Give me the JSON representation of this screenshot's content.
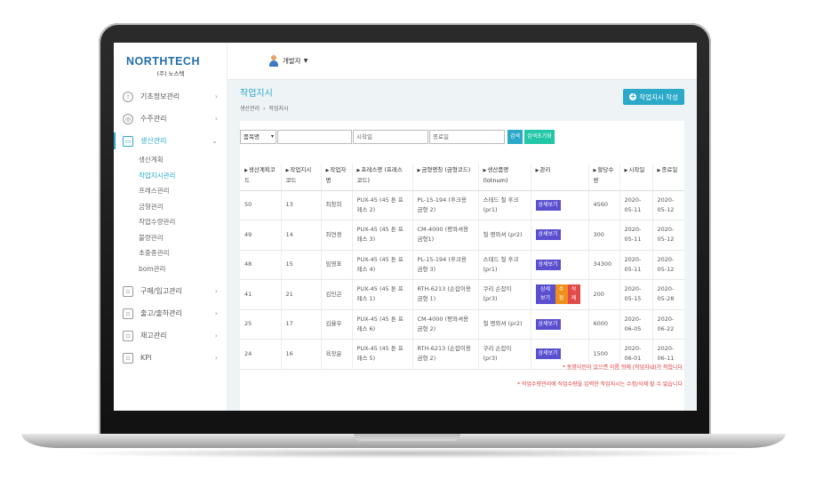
{
  "app": {
    "logo_main": "NORTHTECH",
    "logo_sub": "(주) 노스텍"
  },
  "colors": {
    "accent": "#2aa9c9",
    "detail_badge": "#5a4fcf",
    "edit_badge": "#ef8f1b",
    "delete_badge": "#e04a4a",
    "notice": "#e23a3a"
  },
  "topbar": {
    "user_name": "개발자"
  },
  "sidebar": {
    "items": [
      {
        "label": "기초정보관리",
        "icon": "info-icon"
      },
      {
        "label": "수주관리",
        "icon": "globe-icon"
      },
      {
        "label": "생산관리",
        "icon": "folder-icon"
      },
      {
        "label": "구매/입고관리",
        "icon": "cart-icon"
      },
      {
        "label": "출고/출하관리",
        "icon": "truck-icon"
      },
      {
        "label": "재고관리",
        "icon": "box-icon"
      },
      {
        "label": "KPI",
        "icon": "chart-icon"
      }
    ],
    "sub_items": [
      "생산계획",
      "작업지시관리",
      "프레스관리",
      "금형관리",
      "작업수량관리",
      "불량관리",
      "초중종관리",
      "bom관리"
    ]
  },
  "page": {
    "title": "작업지시",
    "breadcrumb": [
      "생산관리",
      "작업지시"
    ],
    "create_button": "작업지시 작성"
  },
  "search": {
    "select_value": "품목명",
    "keyword_placeholder": "",
    "start_placeholder": "시작일",
    "end_placeholder": "종료일",
    "search_button": "검색",
    "reset_button": "검색초기화"
  },
  "table": {
    "headers": [
      "생산계획코드",
      "작업지시코드",
      "작업자명",
      "프레스명 (프레스코드)",
      "금형명칭 (금형코드)",
      "생산품명 (lotnum)",
      "관리",
      "할당수량",
      "시작일",
      "종료일"
    ],
    "detail_label": "상세보기",
    "detail_label_split": "상세 보기",
    "edit_label_split": "수 정",
    "delete_label_split": "삭 제",
    "rows": [
      {
        "plan": "50",
        "order": "13",
        "worker": "최창희",
        "press": "PUX-45 (45 톤 프레스 2)",
        "mold": "PL-15-194 (후크용 금형 2)",
        "product": "스테드 철 후크 (pr1)",
        "editable": false,
        "qty": "4560",
        "start": "2020-05-11",
        "end": "2020-05-12"
      },
      {
        "plan": "49",
        "order": "14",
        "worker": "최연경",
        "press": "PUX-45 (45 톤 프레스 3)",
        "mold": "CM-4000 (평와셔용 금형1)",
        "product": "철 평와셔 (pr2)",
        "editable": false,
        "qty": "300",
        "start": "2020-05-11",
        "end": "2020-05-12"
      },
      {
        "plan": "48",
        "order": "15",
        "worker": "임영표",
        "press": "PUX-45 (45 톤 프레스 4)",
        "mold": "PL-15-194 (후크용 금형 3)",
        "product": "스테드 철 후크 (pr1)",
        "editable": false,
        "qty": "34300",
        "start": "2020-05-11",
        "end": "2020-05-12"
      },
      {
        "plan": "41",
        "order": "21",
        "worker": "김민곤",
        "press": "PUX-45 (45 톤 프레스 1)",
        "mold": "RTH-6213 (손잡이용 금형 1)",
        "product": "쿠리 손잡이 (pr3)",
        "editable": true,
        "qty": "200",
        "start": "2020-05-15",
        "end": "2020-05-28"
      },
      {
        "plan": "25",
        "order": "17",
        "worker": "김율우",
        "press": "PUX-45 (45 톤 프레스 6)",
        "mold": "CM-4000 (평와셔용 금형 2)",
        "product": "철 평와셔 (pr2)",
        "editable": false,
        "qty": "6000",
        "start": "2020-06-05",
        "end": "2020-06-22"
      },
      {
        "plan": "24",
        "order": "16",
        "worker": "육장윤",
        "press": "PUX-45 (45 톤 프레스 5)",
        "mold": "RTH-6213 (손잡이용 금형 2)",
        "product": "쿠리 손잡이 (pr3)",
        "editable": false,
        "qty": "1500",
        "start": "2020-06-01",
        "end": "2020-06-11"
      }
    ]
  },
  "notes": [
    "* 동명이인이 있으면 이름 뒤에 (작업자id)가 적힙니다",
    "* 작업수량관리에 작업수량을 입력한 작업지시는 수정/삭제 할 수 없습니다"
  ]
}
